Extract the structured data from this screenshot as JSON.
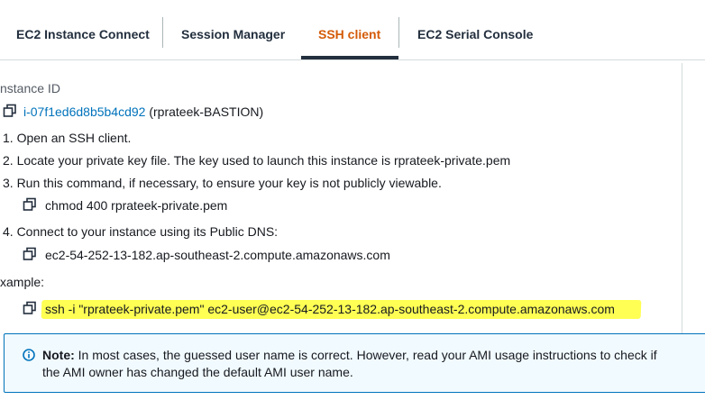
{
  "tabs": [
    {
      "label": "EC2 Instance Connect",
      "active": false
    },
    {
      "label": "Session Manager",
      "active": false
    },
    {
      "label": "SSH client",
      "active": true
    },
    {
      "label": "EC2 Serial Console",
      "active": false
    }
  ],
  "colors": {
    "active_tab": "#d45b07",
    "link": "#0073bb",
    "highlight": "#ffff54",
    "note_bg": "#f1faff"
  },
  "instance": {
    "label": "nstance ID",
    "id": "i-07f1ed6d8b5b4cd92",
    "name": "(rprateek-BASTION)"
  },
  "steps": {
    "step1": "1. Open an SSH client.",
    "step2": "2. Locate your private key file. The key used to launch this instance is rprateek-private.pem",
    "step3": "3. Run this command, if necessary, to ensure your key is not publicly viewable.",
    "chmod_cmd": "chmod 400 rprateek-private.pem",
    "step4": "4. Connect to your instance using its Public DNS:",
    "public_dns": "ec2-54-252-13-182.ap-southeast-2.compute.amazonaws.com"
  },
  "example": {
    "label": "xample:",
    "command": "ssh -i \"rprateek-private.pem\" ec2-user@ec2-54-252-13-182.ap-southeast-2.compute.amazonaws.com"
  },
  "note": {
    "bold": "Note:",
    "line1": " In most cases, the guessed user name is correct. However, read your AMI usage instructions to check if",
    "line2": "the AMI owner has changed the default AMI user name."
  },
  "icons": {
    "copy": "copy-icon",
    "info": "info-icon"
  }
}
